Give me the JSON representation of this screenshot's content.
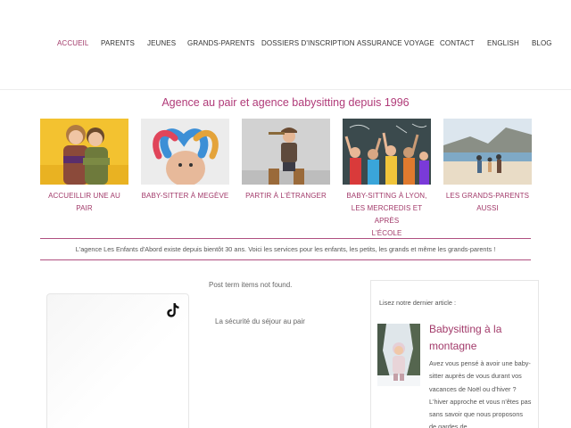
{
  "nav": {
    "items": [
      {
        "label": "ACCUEIL",
        "active": true
      },
      {
        "label": "PARENTS"
      },
      {
        "label": "JEUNES"
      },
      {
        "label": "GRANDS-PARENTS"
      },
      {
        "label": "DOSSIERS D'INSCRIPTION"
      },
      {
        "label": "ASSURANCE VOYAGE"
      },
      {
        "label": "CONTACT"
      },
      {
        "label": "ENGLISH"
      },
      {
        "label": "BLOG"
      }
    ]
  },
  "tagline": "Agence au pair et agence babysitting depuis 1996",
  "cards": [
    {
      "caption": "ACCUEILLIR UNE AU PAIR",
      "image": "two-children-photo"
    },
    {
      "caption": "BABY-SITTER À MEGÈVE",
      "image": "painted-hands-heart-photo"
    },
    {
      "caption": "PARTIR À L'ÉTRANGER",
      "image": "traveler-with-spyglass-photo"
    },
    {
      "caption_lines": [
        "BABY-SITTING À LYON,",
        "LES MERCREDIS ET APRÈS",
        "L'ÉCOLE"
      ],
      "image": "children-cheering-chalkboard-photo"
    },
    {
      "caption_lines": [
        "LES GRANDS-PARENTS",
        "AUSSI"
      ],
      "image": "family-on-beach-photo"
    }
  ],
  "intro": "L'agence Les Enfants d'Abord existe depuis bientôt 30 ans. Voici les services pour les enfants, les petits, les grands et même les grands-parents !",
  "main": {
    "not_found": "Post term items not found.",
    "link": "La sécurité du séjour au pair"
  },
  "tiktok": {
    "icon": "tiktok-icon"
  },
  "sidebar": {
    "label": "Lisez notre dernier article :",
    "post_title": "Babysitting à la montagne",
    "excerpt": "Avez vous pensé à avoir une baby-sitter auprès de vous durant vos vacances de Noël ou d'hiver ?     L'hiver approche et vous n'êtes pas sans savoir que nous proposons de gardes de",
    "thumb": "child-in-snow-photo"
  },
  "colors": {
    "accent": "#a23a6a",
    "tagline": "#b03a78",
    "rule": "#b05080"
  }
}
